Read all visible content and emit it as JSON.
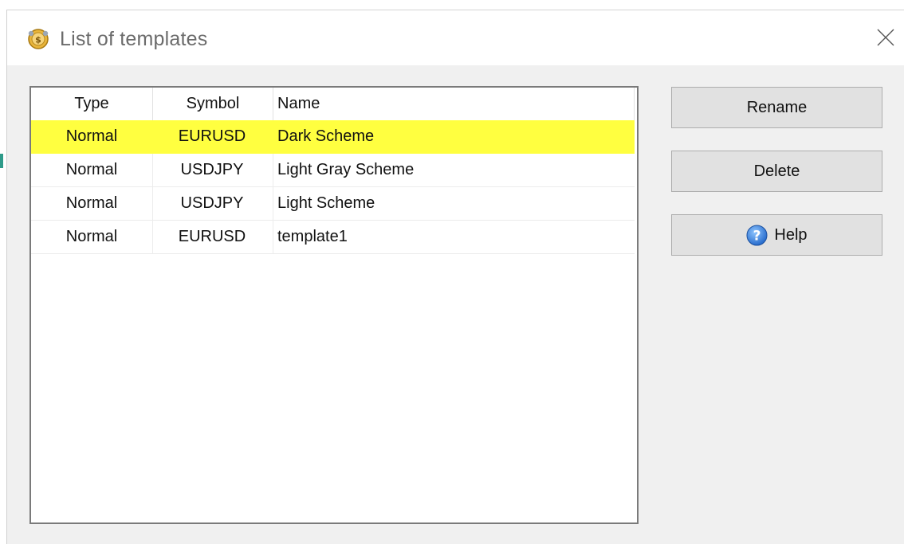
{
  "dialog": {
    "title": "List of templates"
  },
  "table": {
    "columns": [
      "Type",
      "Symbol",
      "Name"
    ],
    "rows": [
      {
        "type": "Normal",
        "symbol": "EURUSD",
        "name": "Dark Scheme",
        "selected": true
      },
      {
        "type": "Normal",
        "symbol": "USDJPY",
        "name": "Light Gray Scheme",
        "selected": false
      },
      {
        "type": "Normal",
        "symbol": "USDJPY",
        "name": "Light Scheme",
        "selected": false
      },
      {
        "type": "Normal",
        "symbol": "EURUSD",
        "name": "template1",
        "selected": false
      }
    ],
    "selected_row_color": "#ffff40"
  },
  "buttons": {
    "rename_label": "Rename",
    "delete_label": "Delete",
    "help_label": "Help"
  },
  "icons": {
    "app": "coin-icon",
    "close": "close-icon",
    "help": "help-icon"
  }
}
